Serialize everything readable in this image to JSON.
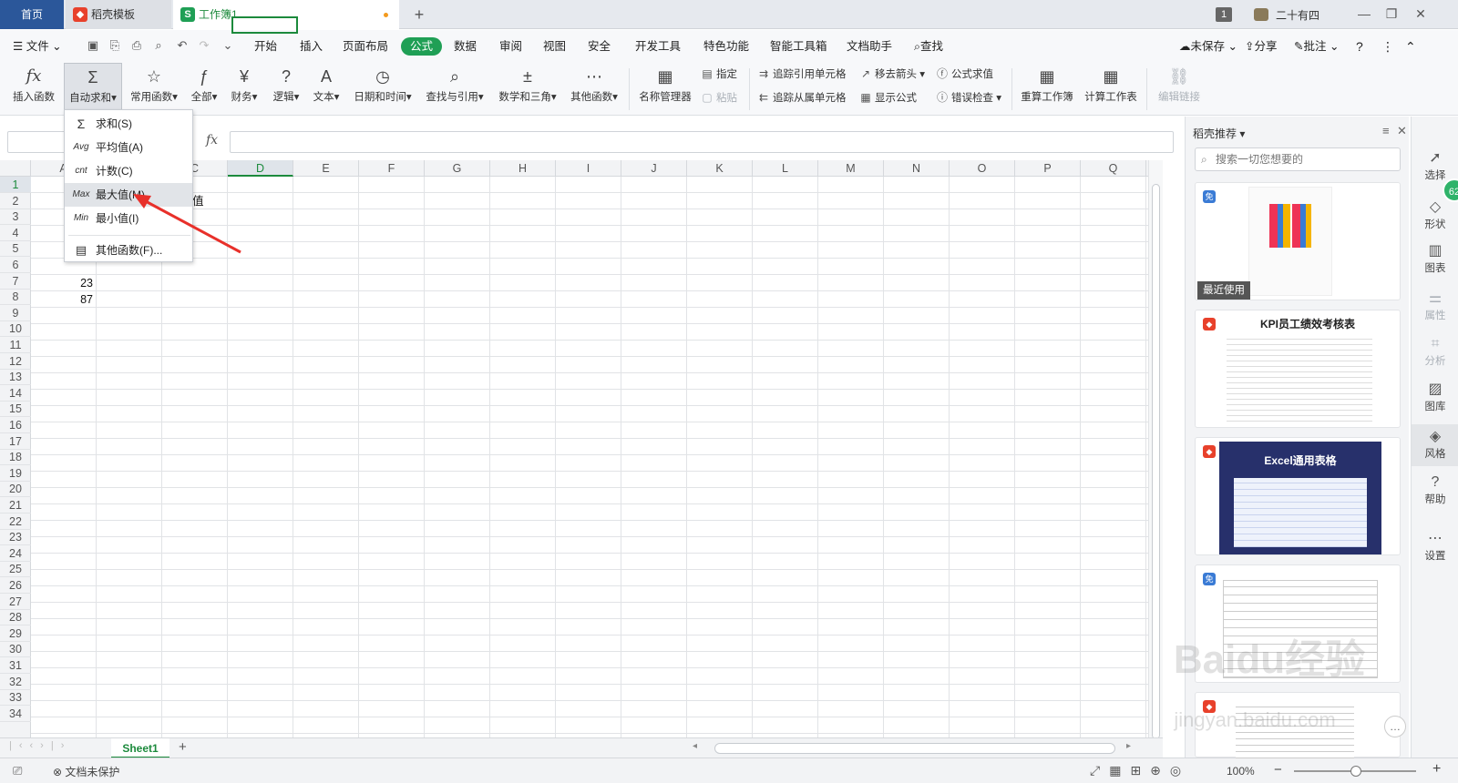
{
  "tabs": {
    "home": "首页",
    "templates": "稻壳模板",
    "workbook": "工作簿1",
    "window_count": "1",
    "user_name": "二十有四"
  },
  "menubar": {
    "file": "文件",
    "items": [
      "开始",
      "插入",
      "页面布局",
      "公式",
      "数据",
      "审阅",
      "视图",
      "安全",
      "开发工具",
      "特色功能",
      "智能工具箱",
      "文档助手"
    ],
    "search": "查找",
    "unsaved": "未保存",
    "share": "分享",
    "comment": "批注"
  },
  "ribbon": {
    "insert_function": "插入函数",
    "autosum": "自动求和",
    "common_functions": "常用函数",
    "all": "全部",
    "finance": "财务",
    "logic": "逻辑",
    "text": "文本",
    "datetime": "日期和时间",
    "lookup": "查找与引用",
    "math": "数学和三角",
    "other_functions": "其他函数",
    "name_manager": "名称管理器",
    "specify": "指定",
    "paste": "粘贴",
    "trace_precedents": "追踪引用单元格",
    "trace_dependents": "追踪从属单元格",
    "remove_arrows": "移去箭头",
    "show_formulas": "显示公式",
    "evaluate_formula": "公式求值",
    "error_check": "错误检查",
    "recalc_sheet": "重算工作簿",
    "calc_sheet": "计算工作表",
    "edit_links": "编辑链接"
  },
  "formula_bar": {
    "fx": "fx"
  },
  "grid": {
    "columns": [
      "A",
      "B",
      "C",
      "D",
      "E",
      "F",
      "G",
      "H",
      "I",
      "J",
      "K",
      "L",
      "M",
      "N",
      "O",
      "P",
      "Q"
    ],
    "selected_column": "D",
    "selected_row": "1",
    "c1_partial": "值",
    "b6": "23",
    "b7": "87"
  },
  "dropdown": {
    "items": [
      {
        "icon": "Σ",
        "label": "求和(S)"
      },
      {
        "icon": "Avg",
        "label": "平均值(A)"
      },
      {
        "icon": "cnt",
        "label": "计数(C)"
      },
      {
        "icon": "Max",
        "label": "最大值(M)"
      },
      {
        "icon": "Min",
        "label": "最小值(I)"
      },
      {
        "icon": "▤",
        "label": "其他函数(F)..."
      }
    ]
  },
  "sheets": {
    "active": "Sheet1"
  },
  "statusbar": {
    "protection": "文档未保护",
    "zoom": "100%"
  },
  "panel": {
    "title": "稻壳推荐",
    "search_placeholder": "搜索一切您想要的",
    "recent_label": "最近使用",
    "card2_title": "KPI员工绩效考核表",
    "card3_title": "Excel通用表格",
    "free_badge": "免"
  },
  "rail": {
    "items": [
      "选择",
      "形状",
      "图表",
      "属性",
      "分析",
      "图库",
      "风格",
      "帮助",
      "设置"
    ],
    "badge": "62"
  },
  "watermark": {
    "text": "Baidu经验",
    "url": "jingyan.baidu.com"
  },
  "colors": {
    "accent": "#1f9f55",
    "home_tab": "#2b579a",
    "arrow": "#e8302a"
  }
}
